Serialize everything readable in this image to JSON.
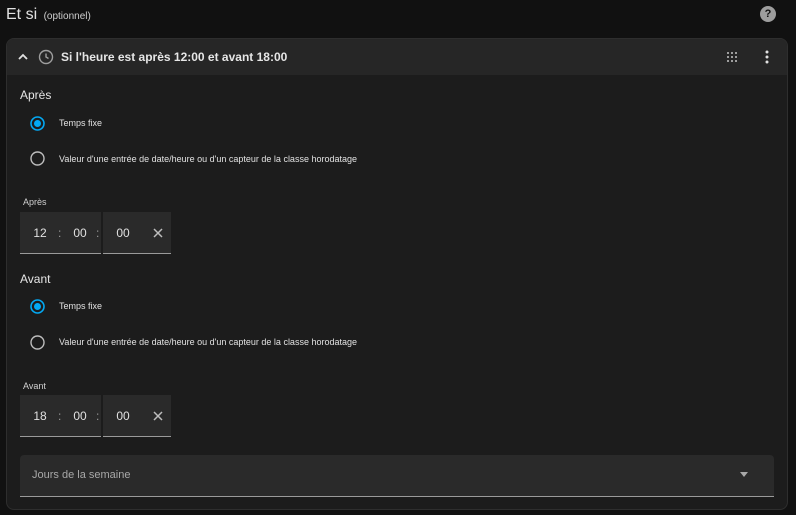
{
  "header": {
    "title": "Et si",
    "optional": "(optionnel)"
  },
  "condition": {
    "title": "Si l'heure est après 12:00 et avant 18:00",
    "after": {
      "section_label": "Après",
      "options": [
        {
          "label": "Temps fixe",
          "selected": true
        },
        {
          "label": "Valeur d'une entrée de date/heure ou d'un capteur de la classe horodatage",
          "selected": false
        }
      ],
      "field_caption": "Après",
      "time": {
        "hours": "12",
        "minutes": "00",
        "seconds": "00"
      }
    },
    "before": {
      "section_label": "Avant",
      "options": [
        {
          "label": "Temps fixe",
          "selected": true
        },
        {
          "label": "Valeur d'une entrée de date/heure ou d'un capteur de la classe horodatage",
          "selected": false
        }
      ],
      "field_caption": "Avant",
      "time": {
        "hours": "18",
        "minutes": "00",
        "seconds": "00"
      }
    },
    "weekdays_placeholder": "Jours de la semaine"
  },
  "colors": {
    "accent": "#03a9f4",
    "background": "#111111",
    "card": "#1c1c1c"
  },
  "icons": [
    "help-icon",
    "chevron-up-icon",
    "clock-icon",
    "drag-handle-icon",
    "more-vertical-icon",
    "clear-icon",
    "chevron-down-icon"
  ]
}
